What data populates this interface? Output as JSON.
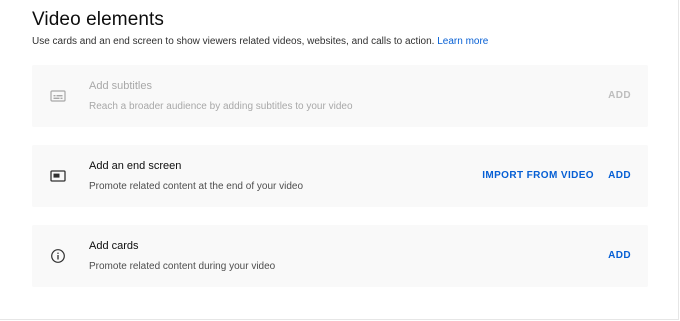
{
  "header": {
    "title": "Video elements",
    "description": "Use cards and an end screen to show viewers related videos, websites, and calls to action.",
    "learn_more": "Learn more"
  },
  "elements": [
    {
      "icon": "subtitles-icon",
      "title": "Add subtitles",
      "description": "Reach a broader audience by adding subtitles to your video",
      "add_label": "ADD",
      "enabled": false
    },
    {
      "icon": "end-screen-icon",
      "title": "Add an end screen",
      "description": "Promote related content at the end of your video",
      "import_label": "IMPORT FROM VIDEO",
      "add_label": "ADD",
      "enabled": true
    },
    {
      "icon": "info-icon",
      "title": "Add cards",
      "description": "Promote related content during your video",
      "add_label": "ADD",
      "enabled": true
    }
  ],
  "colors": {
    "accent": "#065fd4",
    "card_background": "#f9f9f9",
    "disabled_text": "#a8a8a8"
  }
}
